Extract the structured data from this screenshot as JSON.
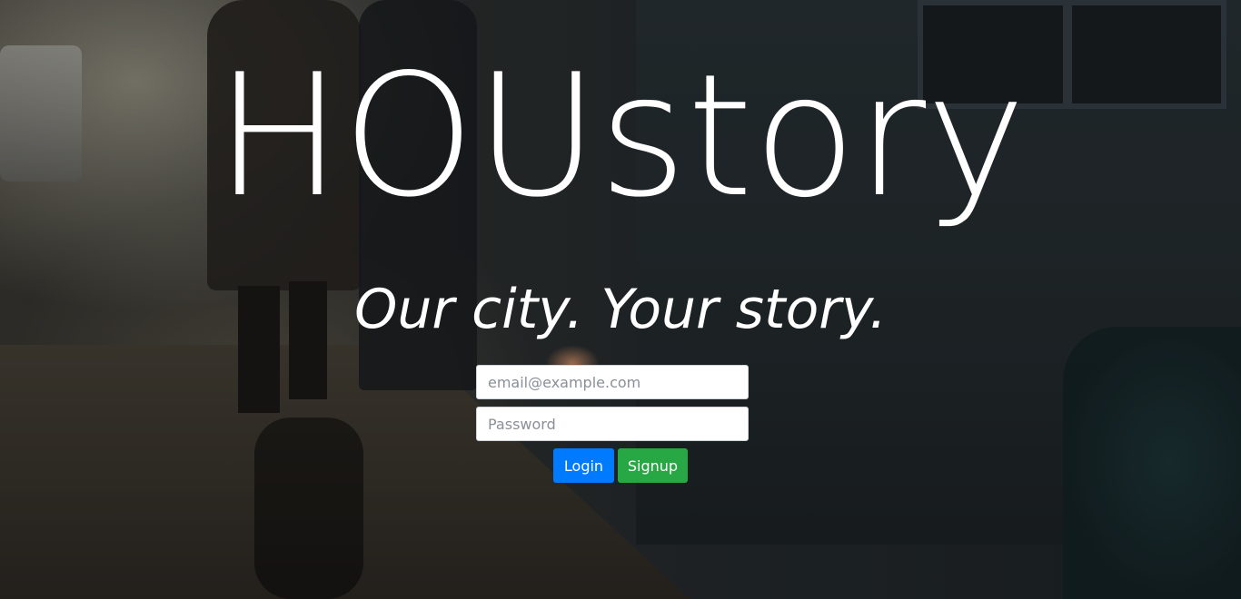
{
  "hero": {
    "title": "HOUstory",
    "tagline": "Our city. Your story."
  },
  "form": {
    "email_placeholder": "email@example.com",
    "password_placeholder": "Password",
    "login_label": "Login",
    "signup_label": "Signup"
  },
  "colors": {
    "login_button": "#007bff",
    "signup_button": "#28a745",
    "text": "#ffffff"
  }
}
